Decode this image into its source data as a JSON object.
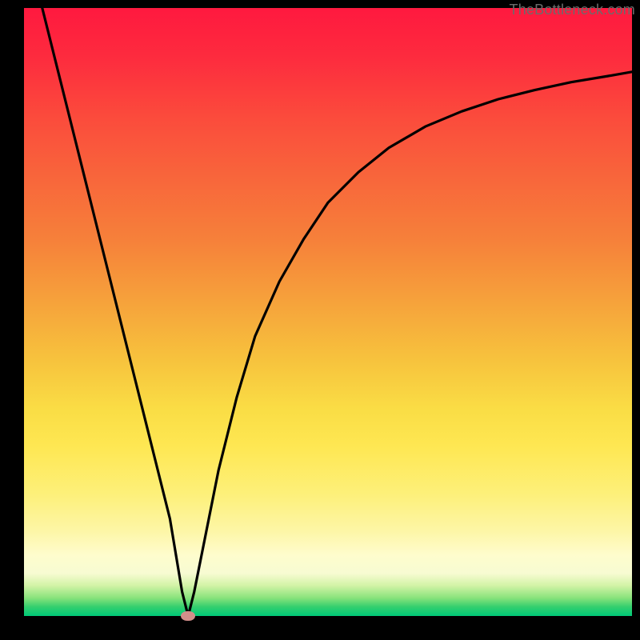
{
  "attribution": "TheBottleneck.com",
  "colors": {
    "top": "#ff193f",
    "mid": "#f7c33d",
    "bottom": "#00c978",
    "curve": "#000000",
    "marker": "#d38e8a",
    "frame": "#000000"
  },
  "chart_data": {
    "type": "line",
    "title": "",
    "xlabel": "",
    "ylabel": "",
    "xlim": [
      0,
      100
    ],
    "ylim": [
      0,
      100
    ],
    "grid": false,
    "legend": false,
    "series": [
      {
        "name": "bottleneck-curve",
        "x": [
          3,
          6,
          10,
          14,
          17,
          20,
          22,
          24,
          25,
          26,
          27,
          28,
          30,
          32,
          35,
          38,
          42,
          46,
          50,
          55,
          60,
          66,
          72,
          78,
          84,
          90,
          96,
          100
        ],
        "y": [
          100,
          88,
          72,
          56,
          44,
          32,
          24,
          16,
          10,
          4,
          0,
          4,
          14,
          24,
          36,
          46,
          55,
          62,
          68,
          73,
          77,
          80.5,
          83,
          85,
          86.5,
          87.8,
          88.8,
          89.5
        ]
      }
    ],
    "annotations": [
      {
        "name": "vertex-marker",
        "x": 27,
        "y": 0
      }
    ]
  }
}
